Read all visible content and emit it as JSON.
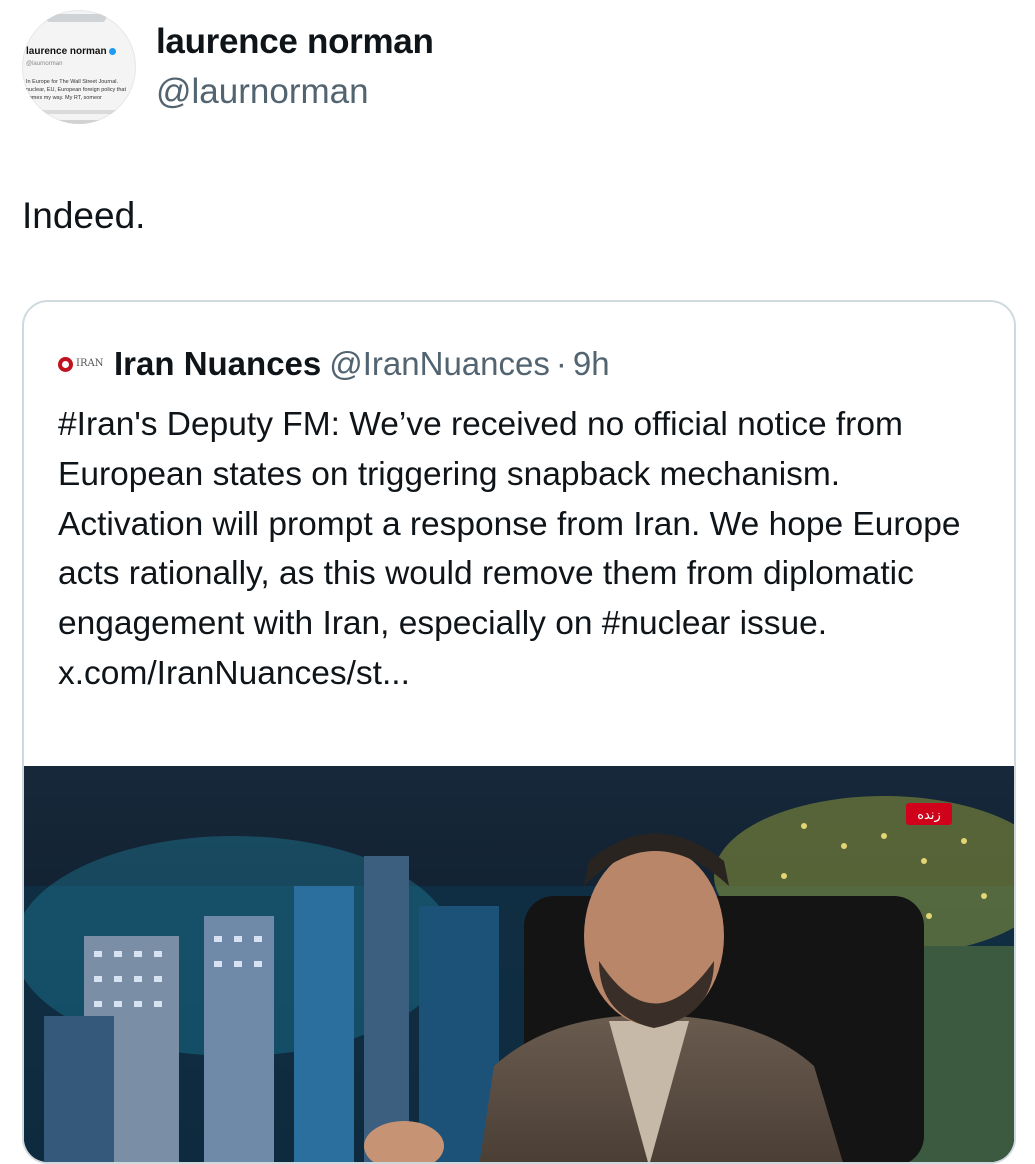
{
  "author": {
    "name": "laurence norman",
    "handle": "@laurnorman",
    "avatar": {
      "mini_name": "laurence norman",
      "mini_handle": "@laurnorman",
      "mini_bio": "In Europe for The Wall Street Journal. nuclear, EU, European foreign policy that comes my way. My RT, someor"
    }
  },
  "tweet": {
    "text": "Indeed."
  },
  "quote": {
    "name": "Iran Nuances",
    "handle": "@IranNuances",
    "separator": "·",
    "time": "9h",
    "logo_text": "IRAN",
    "body": "#Iran's Deputy FM: We’ve received no official notice from European states on triggering snapback mechanism. Activation will prompt a response from Iran. We hope Europe acts rationally, as this would remove them from diplomatic engagement with Iran, especially on #nuclear issue. x.com/IranNuances/st...",
    "media": {
      "live_badge": "زنده",
      "live_badge_color": "#d0021b"
    }
  },
  "colors": {
    "text": "#0f1419",
    "secondary": "#536471",
    "border": "#cfd9de",
    "verified": "#1d9bf0"
  },
  "icons": [
    "verified-badge-icon",
    "iran-nuances-logo"
  ]
}
